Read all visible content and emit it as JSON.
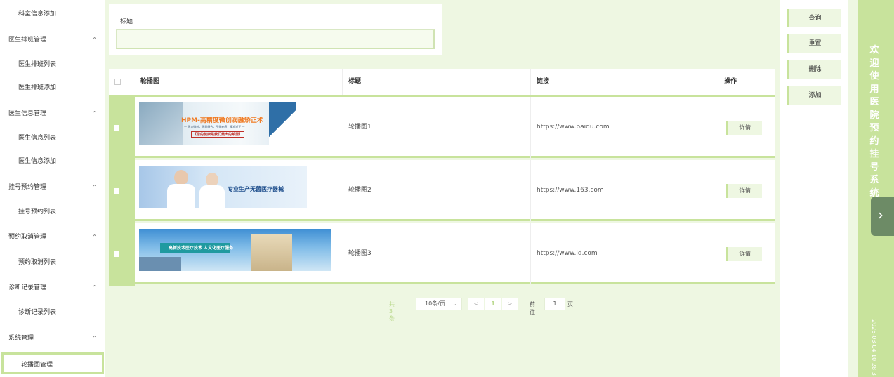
{
  "sidebar": {
    "items": [
      {
        "type": "sub",
        "label": "科室信息添加"
      },
      {
        "type": "group",
        "label": "医生排班管理",
        "arrow": "^"
      },
      {
        "type": "sub",
        "label": "医生排班列表"
      },
      {
        "type": "sub",
        "label": "医生排班添加"
      },
      {
        "type": "group",
        "label": "医生信息管理",
        "arrow": "^"
      },
      {
        "type": "sub",
        "label": "医生信息列表"
      },
      {
        "type": "sub",
        "label": "医生信息添加"
      },
      {
        "type": "group",
        "label": "挂号预约管理",
        "arrow": "^"
      },
      {
        "type": "sub",
        "label": "挂号预约列表"
      },
      {
        "type": "group",
        "label": "预约取消管理",
        "arrow": "^"
      },
      {
        "type": "sub",
        "label": "预约取消列表"
      },
      {
        "type": "group",
        "label": "诊断记录管理",
        "arrow": "^"
      },
      {
        "type": "sub",
        "label": "诊断记录列表"
      },
      {
        "type": "group",
        "label": "系统管理",
        "arrow": "^"
      }
    ],
    "active": "轮播图管理"
  },
  "search": {
    "label": "标题",
    "value": "",
    "placeholder": ""
  },
  "table": {
    "headers": [
      "轮播图",
      "标题",
      "链接",
      "操作"
    ],
    "rows": [
      {
        "title": "轮播图1",
        "url": "https://www.baidu.com",
        "banner_title": "HPM-高精度微创润融矫正术",
        "banner_sub": "— 无刀微创，无需缝合，不留疤痕，精准矫正 —",
        "banner_tag": "【您的健康是我们最大的希望】",
        "action": "详情"
      },
      {
        "title": "轮播图2",
        "url": "https://www.163.com",
        "banner_title": "专业生产无菌医疗器械",
        "action": "详情"
      },
      {
        "title": "轮播图3",
        "url": "https://www.jd.com",
        "banner_title": "高新技术医疗技术 人文化医疗服务",
        "action": "详情"
      }
    ]
  },
  "pager": {
    "total": "共 3 条",
    "page_size": "10条/页",
    "prev": "<",
    "current_page": "1",
    "next": ">",
    "goto_label": "前往",
    "goto_value": "1",
    "page_word": "页"
  },
  "actions": {
    "query": "查询",
    "reset": "重置",
    "delete": "删除",
    "add": "添加"
  },
  "welcome": {
    "text": "欢迎使用医院预约挂号系统",
    "clock": "2026-03-04 10:28:3"
  },
  "colors": {
    "accent": "#c8e39c",
    "background": "#eef7e2",
    "tab": "#6d8b66"
  },
  "icons": {
    "next_tab": "chevron-right-icon",
    "group_arrow": "chevron-up-icon"
  }
}
